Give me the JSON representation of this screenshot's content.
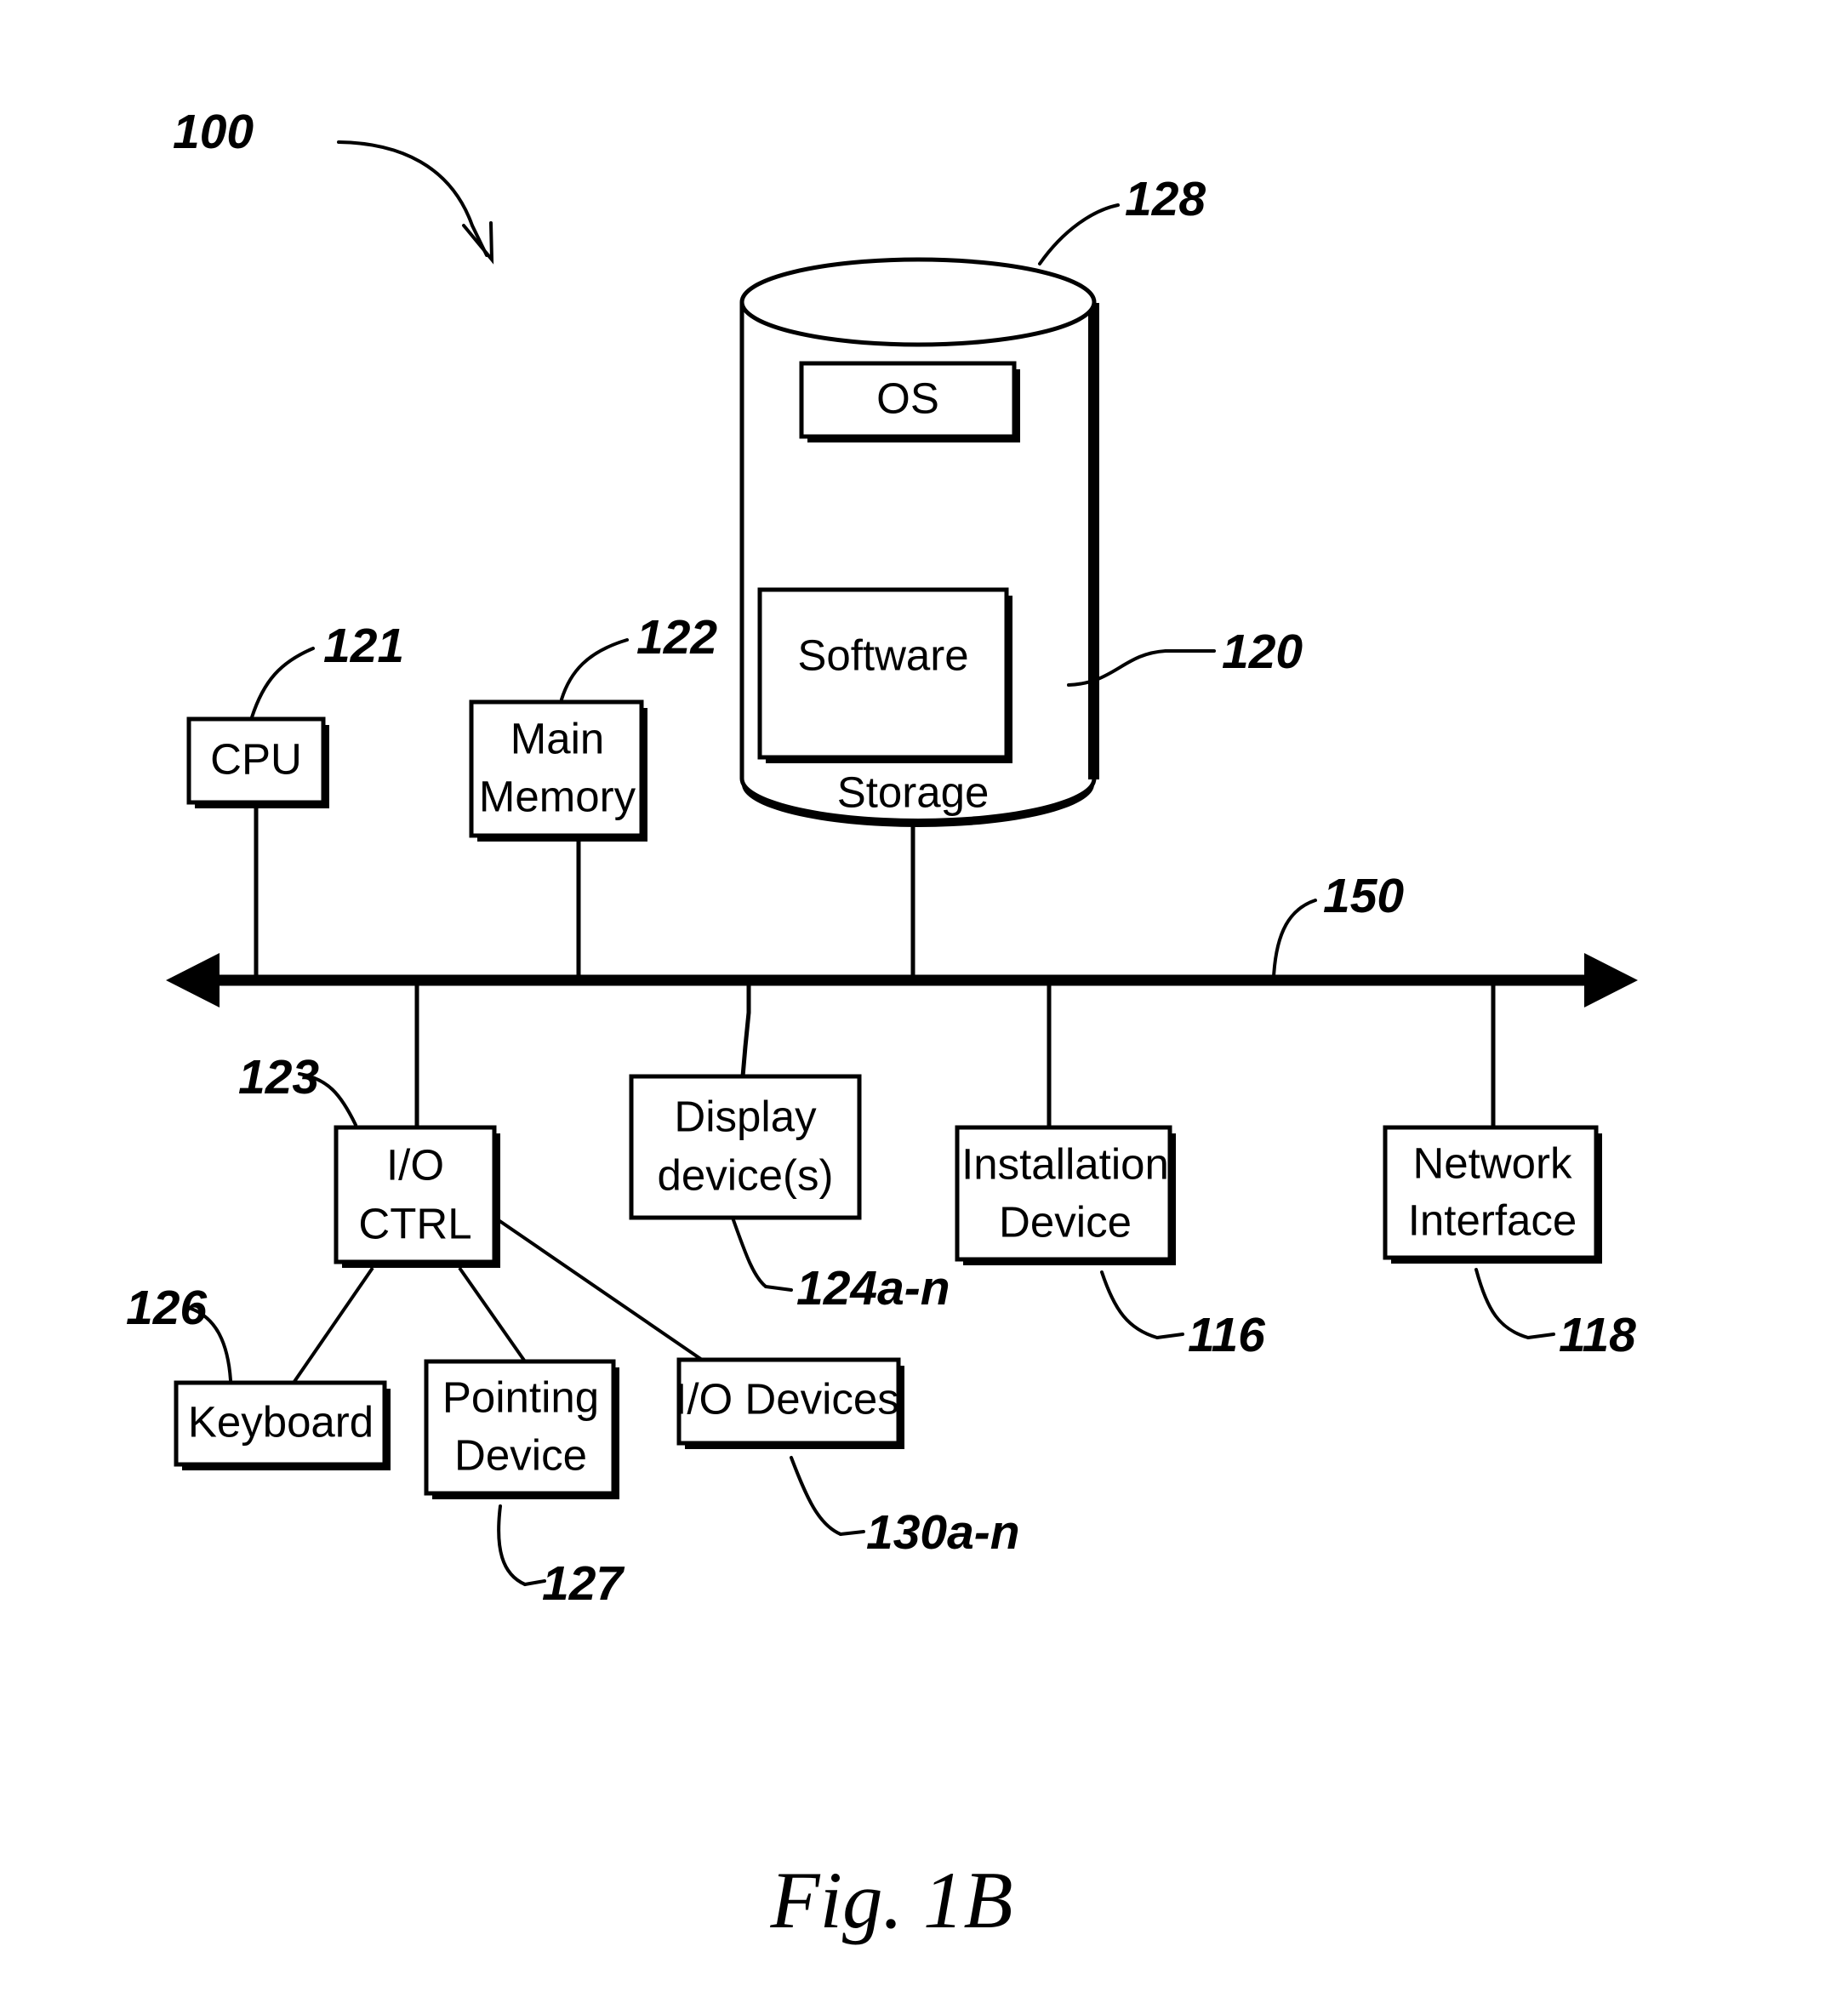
{
  "figure": {
    "caption": "Fig. 1B",
    "system_ref": "100"
  },
  "nodes": {
    "cpu": {
      "label": "CPU",
      "ref": "121"
    },
    "main_memory": {
      "label_line1": "Main",
      "label_line2": "Memory",
      "ref": "122"
    },
    "storage": {
      "label": "Storage",
      "ref": "128"
    },
    "os": {
      "label": "OS"
    },
    "software": {
      "label": "Software",
      "ref": "120"
    },
    "bus": {
      "ref": "150"
    },
    "io_ctrl": {
      "label_line1": "I/O",
      "label_line2": "CTRL",
      "ref": "123"
    },
    "display_devices": {
      "label_line1": "Display",
      "label_line2": "device(s)",
      "ref": "124a-n"
    },
    "installation_device": {
      "label_line1": "Installation",
      "label_line2": "Device",
      "ref": "116"
    },
    "network_interface": {
      "label_line1": "Network",
      "label_line2": "Interface",
      "ref": "118"
    },
    "keyboard": {
      "label": "Keyboard",
      "ref": "126"
    },
    "pointing_device": {
      "label_line1": "Pointing",
      "label_line2": "Device",
      "ref": "127"
    },
    "io_devices": {
      "label": "I/O Devices",
      "ref": "130a-n"
    }
  },
  "colors": {
    "ink": "#000000",
    "paper": "#ffffff"
  }
}
